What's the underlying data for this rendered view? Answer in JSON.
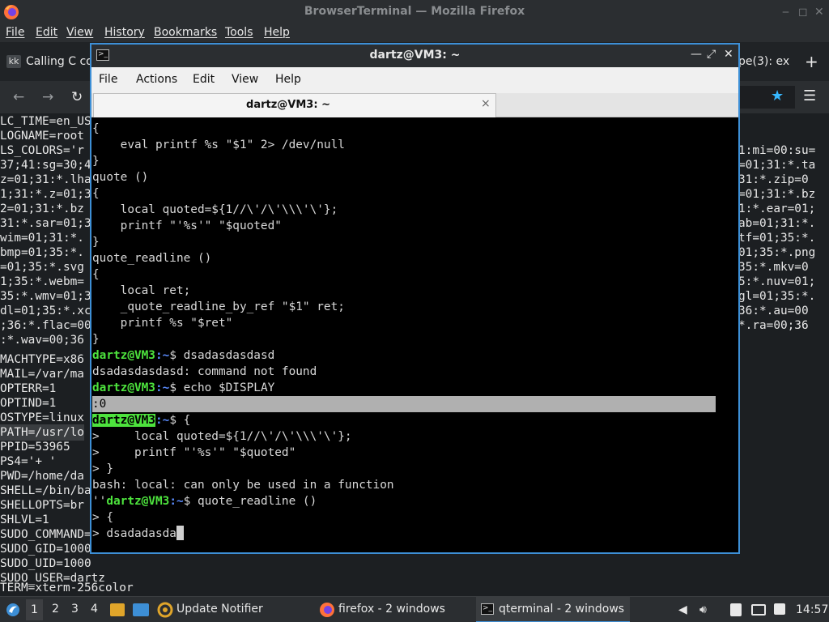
{
  "firefox": {
    "title": "BrowserTerminal — Mozilla Firefox",
    "menu": [
      "File",
      "Edit",
      "View",
      "History",
      "Bookmarks",
      "Tools",
      "Help"
    ],
    "tab_favicon": "kk",
    "tab_title": "Calling C co",
    "tab_right_fragment": "pe(3): ex",
    "env_left": [
      "LC_TIME=en_US",
      "LOGNAME=root",
      "LS_COLORS='r",
      "37;41:sg=30;4",
      "z=01;31:*.lha",
      "1;31:*.z=01;3",
      "2=01;31:*.bz",
      "31:*.sar=01;3",
      "wim=01;31:*.",
      "bmp=01;35:*.",
      "=01;35:*.svg",
      "1;35:*.webm=",
      "35:*.wmv=01;3",
      "dl=01;35:*.xc",
      ";36:*.flac=00",
      ":*.wav=00;36",
      "MACHTYPE=x86",
      "MAIL=/var/ma",
      "OPTERR=1",
      "OPTIND=1",
      "OSTYPE=linux",
      "PATH=/usr/lo",
      "PPID=53965",
      "PS4='+ '",
      "PWD=/home/da",
      "SHELL=/bin/ba",
      "SHELLOPTS=br",
      "SHLVL=1",
      "SUDO_COMMAND=",
      "SUDO_GID=1000",
      "SUDO_UID=1000",
      "SUDO_USER=dartz",
      "TERM=xterm-256color"
    ],
    "env_right": [
      "",
      "",
      "1:mi=00:su=",
      "=01;31:*.ta",
      "31:*.zip=0",
      "=01;31:*.bz",
      "1:*.ear=01;",
      "ab=01;31:*.",
      "tf=01;35:*.",
      "01;35:*.png",
      "35:*.mkv=0",
      "5:*.nuv=01;",
      "gl=01;35:*.",
      "36:*.au=00",
      "*.ra=00;36"
    ]
  },
  "terminal": {
    "window_title": "dartz@VM3: ~",
    "menu": [
      "File",
      "Actions",
      "Edit",
      "View",
      "Help"
    ],
    "tab_title": "dartz@VM3: ~",
    "tab_close": "×",
    "prompt_user": "dartz@VM3",
    "prompt_path": ":~",
    "lines": {
      "l01": "{",
      "l02": "    eval printf %s \"$1\" 2> /dev/null",
      "l03": "}",
      "l04": "quote ()",
      "l05": "{",
      "l06": "    local quoted=${1//\\'/\\'\\\\\\'\\'};",
      "l07": "    printf \"'%s'\" \"$quoted\"",
      "l08": "}",
      "l09": "quote_readline ()",
      "l10": "{",
      "l11": "    local ret;",
      "l12": "    _quote_readline_by_ref \"$1\" ret;",
      "l13": "    printf %s \"$ret\"",
      "l14": "}",
      "cmd1": "$ dsadasdasdasd",
      "l16": "dsadasdasdasd: command not found",
      "cmd2": "$ echo $DISPLAY",
      "l18": ":0",
      "cmd3": "$ {",
      "l20": ">     local quoted=${1//\\'/\\'\\\\\\'\\'};",
      "l21": ">     printf \"'%s'\" \"$quoted\"",
      "l22": "> }",
      "l23": "bash: local: can only be used in a function",
      "l24_prefix": "''",
      "cmd4": "$ quote_readline ()",
      "l25": "> {",
      "l26": "> dsadadasda"
    }
  },
  "taskbar": {
    "workspaces": [
      "1",
      "2",
      "3",
      "4"
    ],
    "items": [
      "Update Notifier",
      "firefox - 2 windows",
      "qterminal - 2 windows"
    ],
    "clock": "14:57"
  },
  "colors": {
    "prompt_green": "#4de33d",
    "path_blue": "#5b8cff",
    "active_border": "#3d8fd6"
  }
}
